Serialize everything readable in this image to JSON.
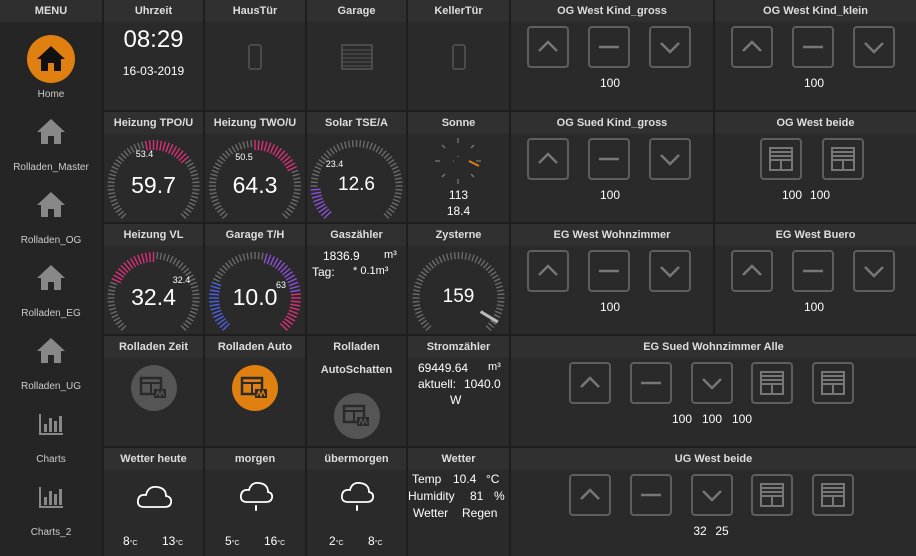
{
  "menu": {
    "title": "MENU",
    "items": [
      {
        "label": "Home",
        "icon": "home-icon"
      },
      {
        "label": "Rolladen_Master",
        "icon": "home-icon"
      },
      {
        "label": "Rolladen_OG",
        "icon": "home-icon"
      },
      {
        "label": "Rolladen_EG",
        "icon": "home-icon"
      },
      {
        "label": "Rolladen_UG",
        "icon": "home-icon"
      },
      {
        "label": "Charts",
        "icon": "bar-chart-icon"
      },
      {
        "label": "Charts_2",
        "icon": "bar-chart-icon"
      }
    ]
  },
  "uhrzeit": {
    "title": "Uhrzeit",
    "time": "08:29",
    "date": "16-03-2019"
  },
  "haustuer": {
    "title": "HausTür"
  },
  "garage": {
    "title": "Garage"
  },
  "kellertuer": {
    "title": "KellerTür"
  },
  "gauges": {
    "heizung_tpo": {
      "title": "Heizung TPO/U",
      "value": "59.7",
      "setpoint": "53.4",
      "level": 0.7
    },
    "heizung_two": {
      "title": "Heizung TWO/U",
      "value": "64.3",
      "setpoint": "50.5",
      "level": 0.75
    },
    "solar_tse": {
      "title": "Solar TSE/A",
      "value": "12.6",
      "setpoint": "23.4",
      "level": 0.15
    },
    "heizung_vl": {
      "title": "Heizung VL",
      "value": "32.4",
      "setpoint": "32.4",
      "level": 0.5
    },
    "garage_th": {
      "title": "Garage T/H",
      "value": "10.0",
      "setpoint": "63",
      "level": 0.25
    },
    "zysterne": {
      "title": "Zysterne",
      "value": "159",
      "level": 0.95
    }
  },
  "sonne": {
    "title": "Sonne",
    "azimuth": "113",
    "elevation": "18.4"
  },
  "gaszaehler": {
    "title": "Gaszähler",
    "line1_value": "1836.9",
    "line1_unit": "m³",
    "line2_label": "Tag:",
    "line2_value": "* 0.1m³"
  },
  "stromzaehler": {
    "title": "Stromzähler",
    "line1_value": "69449.64",
    "line1_unit": "m³",
    "line2_label": "aktuell:",
    "line2_value": "1040.0",
    "line3": "W"
  },
  "rolladen_zeit": {
    "title": "Rolladen Zeit"
  },
  "rolladen_auto": {
    "title": "Rolladen Auto"
  },
  "rolladen_schatten": {
    "title": "Rolladen",
    "subtitle": "AutoSchatten"
  },
  "weather": [
    {
      "title": "Wetter heute",
      "low": "8",
      "high": "13",
      "unit": "°C"
    },
    {
      "title": "morgen",
      "low": "5",
      "high": "16",
      "unit": "°C"
    },
    {
      "title": "übermorgen",
      "low": "2",
      "high": "8",
      "unit": "°C"
    }
  ],
  "wetter": {
    "title": "Wetter",
    "temp_label": "Temp",
    "temp_value": "10.4",
    "temp_unit": "°C",
    "hum_label": "Humidity",
    "hum_value": "81",
    "hum_unit": "%",
    "cond_label": "Wetter",
    "cond_value": "Regen"
  },
  "shutters": {
    "og_west_kind_gross": {
      "title": "OG West Kind_gross",
      "values": [
        "100"
      ]
    },
    "og_west_kind_klein": {
      "title": "OG West Kind_klein",
      "values": [
        "100"
      ]
    },
    "og_sued_kind_gross": {
      "title": "OG Sued Kind_gross",
      "values": [
        "100"
      ]
    },
    "og_west_beide": {
      "title": "OG West beide",
      "values": [
        "100",
        "100"
      ]
    },
    "eg_west_wohnzimmer": {
      "title": "EG West Wohnzimmer",
      "values": [
        "100"
      ]
    },
    "eg_west_buero": {
      "title": "EG West Buero",
      "values": [
        "100"
      ]
    },
    "eg_sued_wohnzimmer_alle": {
      "title": "EG Sued Wohnzimmer Alle",
      "values": [
        "100",
        "100",
        "100"
      ]
    },
    "ug_west_beide": {
      "title": "UG West beide",
      "values": [
        "32",
        "25"
      ]
    }
  },
  "colors": {
    "accent": "#e08010",
    "gauge_pink": "#d8307a",
    "gauge_purple": "#8a4fd8",
    "gauge_blue": "#4a60e0",
    "tile_bg": "#2a2a2a",
    "button_border": "#5e5e5e"
  }
}
